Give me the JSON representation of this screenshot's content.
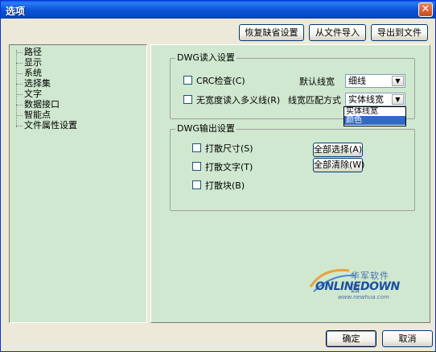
{
  "window": {
    "title": "选项",
    "close_glyph": "✕"
  },
  "top_buttons": {
    "restore_defaults": "恢复缺省设置",
    "import_file": "从文件导入",
    "export_file": "导出到文件"
  },
  "tree": {
    "items": [
      "路径",
      "显示",
      "系统",
      "选择集",
      "文字",
      "数据接口",
      "智能点",
      "文件属性设置"
    ]
  },
  "dwg_read": {
    "title": "DWG读入设置",
    "crc_check": {
      "label": "CRC检查(C)",
      "checked": false
    },
    "no_width_polyline": {
      "label": "无宽度读入多义线(R)",
      "checked": false
    },
    "default_linewidth_label": "默认线宽",
    "default_linewidth_value": "细线",
    "linewidth_match_label": "线宽匹配方式",
    "linewidth_match_value": "实体线宽",
    "linewidth_match_options": [
      "实体线宽",
      "颜色"
    ],
    "linewidth_match_highlighted": "颜色"
  },
  "dwg_write": {
    "title": "DWG输出设置",
    "explode_dimension": {
      "label": "打散尺寸(S)",
      "checked": false
    },
    "explode_text": {
      "label": "打散文字(T)",
      "checked": false
    },
    "explode_block": {
      "label": "打散块(B)",
      "checked": false
    },
    "select_all": "全部选择(A)",
    "clear_all": "全部清除(W)"
  },
  "watermark": {
    "cn": "华军软件园",
    "en": "ONLINEDOWN",
    "url": "www.newhua.com"
  },
  "bottom_buttons": {
    "ok": "确定",
    "cancel": "取消"
  },
  "colors": {
    "panel_bg": "#cfe8cf",
    "dialog_bg": "#ece9d8",
    "titlebar": "#0a56d8",
    "selection": "#316ac5"
  }
}
